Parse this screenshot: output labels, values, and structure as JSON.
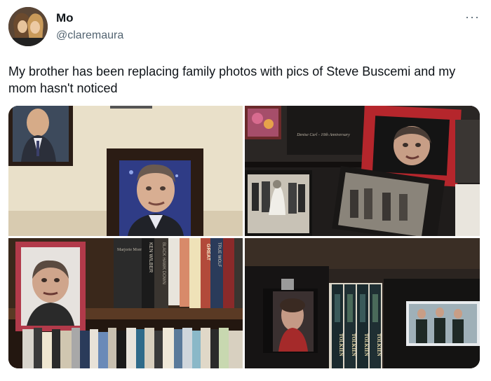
{
  "author": {
    "display_name": "Mo",
    "handle": "@claremaura"
  },
  "icons": {
    "more": "more-options-icon"
  },
  "more_glyph": "···",
  "tweet_text": "My brother has been replacing family photos with pics of Steve Buscemi and my mom hasn't noticed",
  "photos": {
    "top_right_album_caption": "Denise Carl - 10th Anniversary",
    "bottom_left_book_titles": [
      "Marjorie Morningstar",
      "KEN WILBER",
      "BLACK HAWK DOWN",
      "GREAT",
      "TRUE WOLF"
    ],
    "bottom_right_book_titles": [
      "TOLKIEN",
      "TOLKIEN",
      "TOLKIEN",
      "TOLKIEN"
    ]
  }
}
